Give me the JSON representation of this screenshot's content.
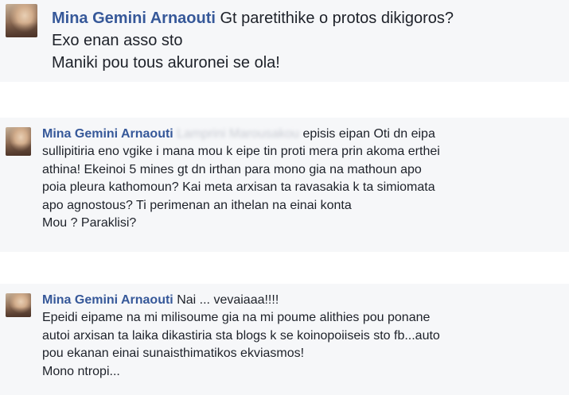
{
  "comments": [
    {
      "author": "Mina Gemini Arnaouti",
      "lines": [
        "Gt paretithike o protos dikigoros?",
        "Exo enan asso sto",
        "Maniki pou tous akuronei se ola!"
      ]
    },
    {
      "author": "Mina Gemini Arnaouti",
      "mention_blurred": "Lamprini Marousakou",
      "lines": [
        "episis eipan Oti dn eipa",
        "sullipitiria eno vgike i mana mou k eipe tin proti mera prin akoma erthei",
        "athina! Ekeinoi 5 mines gt dn irthan para mono gia na mathoun apo",
        "poia pleura kathomoun? Kai meta arxisan ta ravasakia k ta simiomata",
        "apo agnostous? Ti perimenan an ithelan na einai konta",
        "Mou ? Paraklisi?"
      ]
    },
    {
      "author": "Mina Gemini Arnaouti",
      "lines": [
        "Nai ... vevaiaaa!!!!",
        "Epeidi eipame na mi milisoume gia na mi poume alithies pou ponane",
        "autoi arxisan ta laika dikastiria sta blogs k se koinopoiiseis sto fb...auto",
        "pou ekanan einai sunaisthimatikos ekviasmos!",
        "Mono ntropi..."
      ]
    }
  ]
}
